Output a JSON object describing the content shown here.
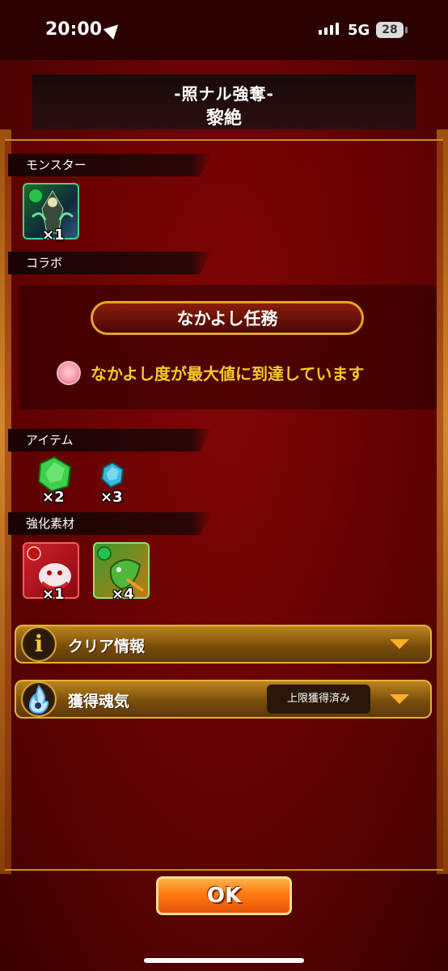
{
  "status_bar": {
    "time": "20:00",
    "network": "5G",
    "battery": "28"
  },
  "header": {
    "title": "-照ナル強奪-",
    "subtitle": "黎絶"
  },
  "sections": {
    "monster": {
      "label": "モンスター",
      "items": [
        {
          "icon": "monster-portrait",
          "count": "×1"
        }
      ]
    },
    "collab": {
      "label": "コラボ",
      "button_label": "なかよし任務",
      "message": "なかよし度が最大値に到達しています",
      "accent": "#f6c92b"
    },
    "items": {
      "label": "アイテム",
      "items": [
        {
          "icon": "green-crystal",
          "count": "×2",
          "color": "#3ed04a"
        },
        {
          "icon": "blue-crystal",
          "count": "×3",
          "color": "#39b8d8"
        }
      ]
    },
    "materials": {
      "label": "強化素材",
      "items": [
        {
          "icon": "red-material-portrait",
          "count": "×1"
        },
        {
          "icon": "green-material-portrait",
          "count": "×4"
        }
      ]
    }
  },
  "accordions": [
    {
      "label": "クリア情報",
      "icon": "info-icon"
    },
    {
      "label": "獲得魂気",
      "icon": "soul-flame-icon",
      "badge": "上限獲得済み"
    }
  ],
  "ok_button": {
    "label": "OK"
  },
  "colors": {
    "panel_red": "#8a0808",
    "gold": "#c8901a",
    "ok_orange": "#ff7a10"
  }
}
